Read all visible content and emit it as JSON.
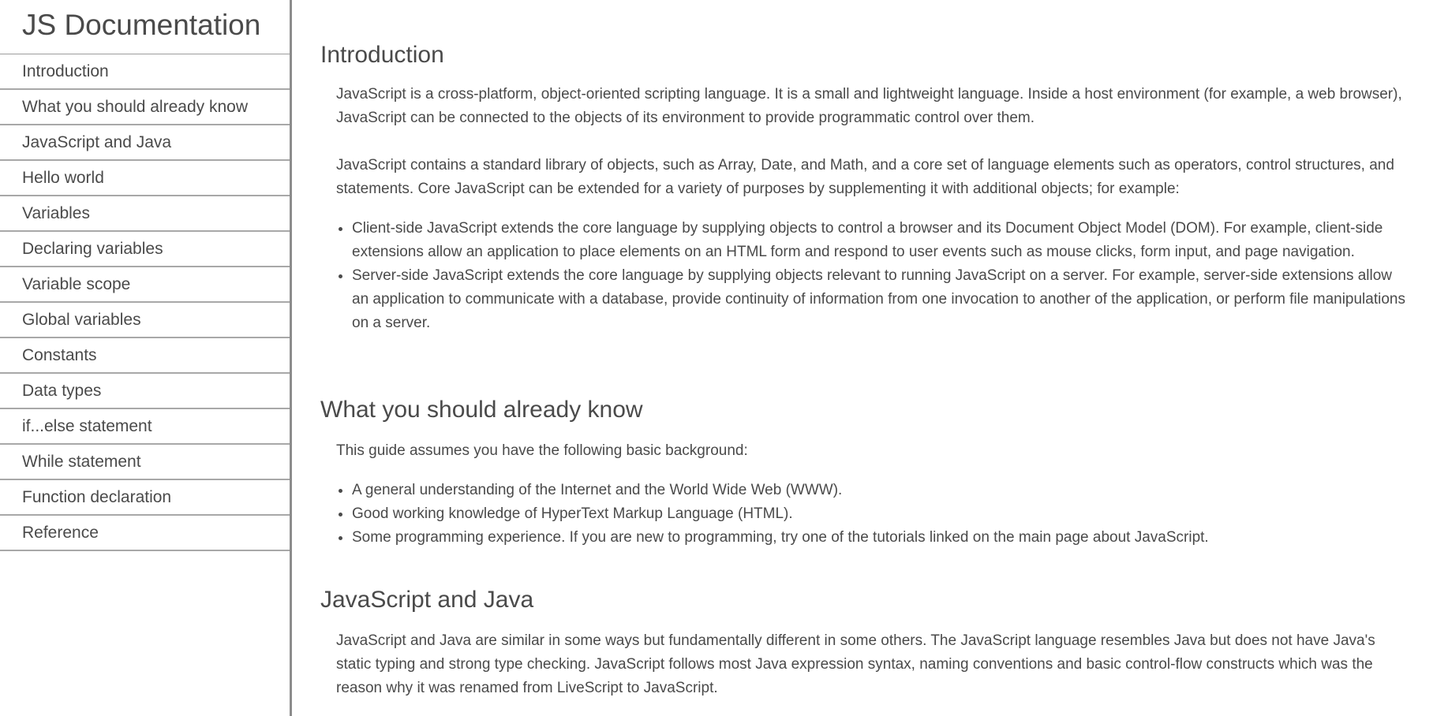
{
  "nav": {
    "title": "JS Documentation",
    "items": [
      {
        "label": "Introduction"
      },
      {
        "label": "What you should already know"
      },
      {
        "label": "JavaScript and Java"
      },
      {
        "label": "Hello world"
      },
      {
        "label": "Variables"
      },
      {
        "label": "Declaring variables"
      },
      {
        "label": "Variable scope"
      },
      {
        "label": "Global variables"
      },
      {
        "label": "Constants"
      },
      {
        "label": "Data types"
      },
      {
        "label": "if...else statement"
      },
      {
        "label": "While statement"
      },
      {
        "label": "Function declaration"
      },
      {
        "label": "Reference"
      }
    ]
  },
  "sections": {
    "introduction": {
      "heading": "Introduction",
      "p1": "JavaScript is a cross-platform, object-oriented scripting language. It is a small and lightweight language. Inside a host environment (for example, a web browser), JavaScript can be connected to the objects of its environment to provide programmatic control over them.",
      "p2": "JavaScript contains a standard library of objects, such as Array, Date, and Math, and a core set of language elements such as operators, control structures, and statements. Core JavaScript can be extended for a variety of purposes by supplementing it with additional objects; for example:",
      "list": [
        "Client-side JavaScript extends the core language by supplying objects to control a browser and its Document Object Model (DOM). For example, client-side extensions allow an application to place elements on an HTML form and respond to user events such as mouse clicks, form input, and page navigation.",
        "Server-side JavaScript extends the core language by supplying objects relevant to running JavaScript on a server. For example, server-side extensions allow an application to communicate with a database, provide continuity of information from one invocation to another of the application, or perform file manipulations on a server."
      ]
    },
    "already_know": {
      "heading": "What you should already know",
      "p1": "This guide assumes you have the following basic background:",
      "list": [
        "A general understanding of the Internet and the World Wide Web (WWW).",
        "Good working knowledge of HyperText Markup Language (HTML).",
        "Some programming experience. If you are new to programming, try one of the tutorials linked on the main page about JavaScript."
      ]
    },
    "js_and_java": {
      "heading": "JavaScript and Java",
      "p1": "JavaScript and Java are similar in some ways but fundamentally different in some others. The JavaScript language resembles Java but does not have Java's static typing and strong type checking. JavaScript follows most Java expression syntax, naming conventions and basic control-flow constructs which was the reason why it was renamed from LiveScript to JavaScript."
    }
  }
}
